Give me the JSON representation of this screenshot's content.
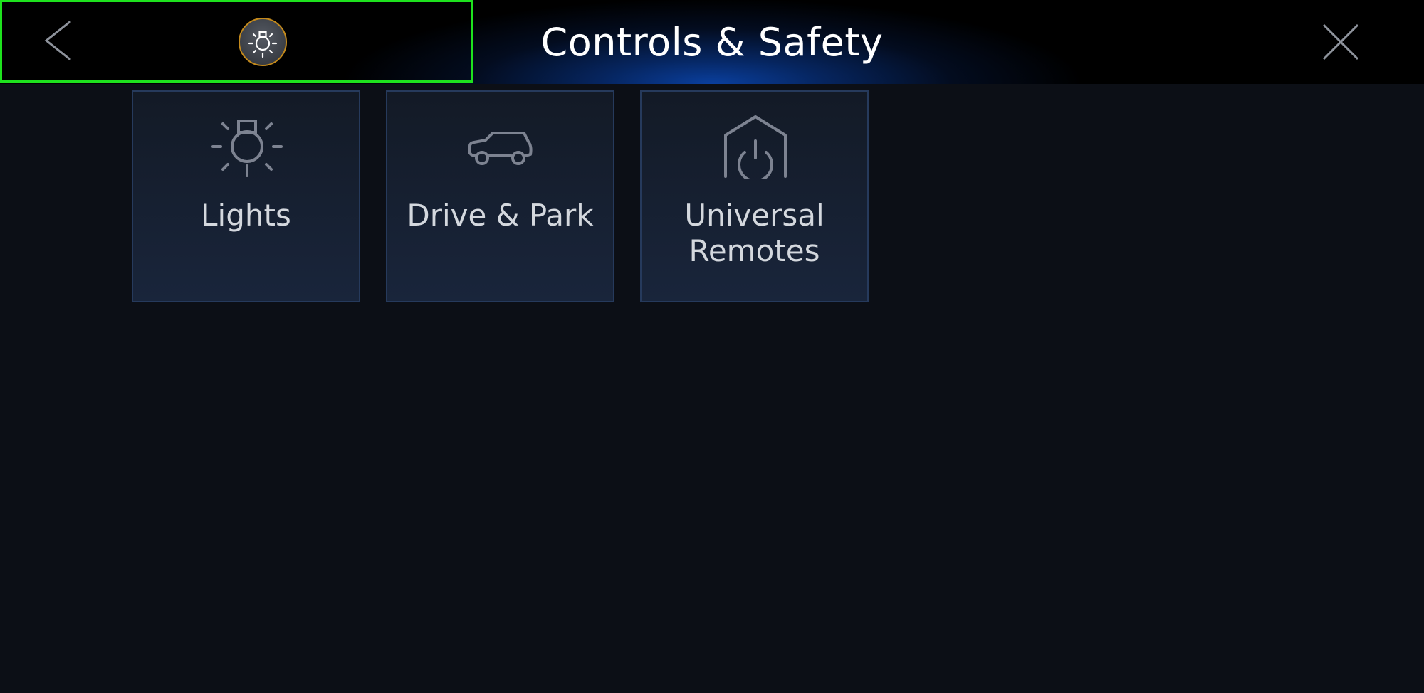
{
  "header": {
    "title": "Controls & Safety",
    "back_icon": "chevron-left-icon",
    "close_icon": "close-icon",
    "shortcut_icon": "light-bulb-icon",
    "highlight_color": "#1ee21e",
    "shortcut_ring_color": "#c48a1c"
  },
  "tiles": [
    {
      "label": "Lights",
      "icon": "light-bulb-icon"
    },
    {
      "label": "Drive & Park",
      "icon": "car-icon"
    },
    {
      "label_line1": "Universal",
      "label_line2": "Remotes",
      "icon": "garage-power-icon"
    }
  ],
  "colors": {
    "background": "#0c0f16",
    "tile_border": "#263a5c",
    "icon_stroke": "#7d8391",
    "accent_glow": "#0a3f9e"
  }
}
